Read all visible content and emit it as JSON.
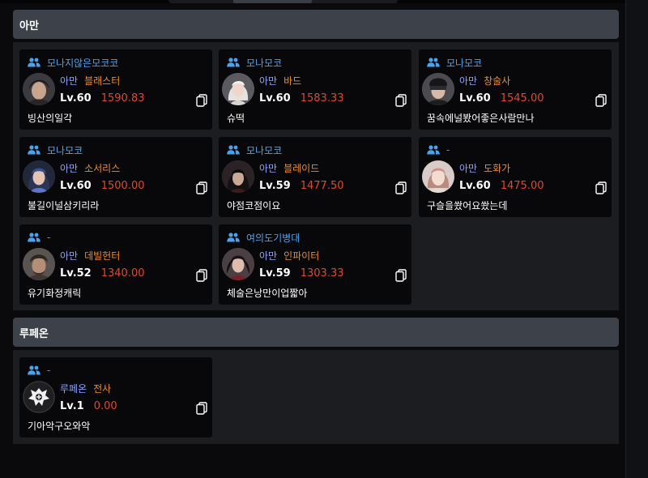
{
  "servers": [
    {
      "name": "아만",
      "characters": [
        {
          "guild": "모나지않은모코코",
          "server": "아만",
          "class": "블래스터",
          "level": "Lv.60",
          "item_level": "1590.83",
          "name": "빙산의일각",
          "avatar": "male-dark-hair"
        },
        {
          "guild": "모나모코",
          "server": "아만",
          "class": "바드",
          "level": "Lv.60",
          "item_level": "1583.33",
          "name": "슈떡",
          "avatar": "female-white-hair"
        },
        {
          "guild": "모나모코",
          "server": "아만",
          "class": "창술사",
          "level": "Lv.60",
          "item_level": "1545.00",
          "name": "꿈속에널봤어좋은사람만나",
          "avatar": "lancer-mask"
        },
        {
          "guild": "모나모코",
          "server": "아만",
          "class": "소서리스",
          "level": "Lv.60",
          "item_level": "1500.00",
          "name": "불길이널삼키리라",
          "avatar": "sorceress-blue"
        },
        {
          "guild": "모나모코",
          "server": "아만",
          "class": "블레이드",
          "level": "Lv.59",
          "item_level": "1477.50",
          "name": "야점코점이요",
          "avatar": "blade-hood"
        },
        {
          "guild": "-",
          "server": "아만",
          "class": "도화가",
          "level": "Lv.60",
          "item_level": "1475.00",
          "name": "구슬을쐈어요쐈는데",
          "avatar": "artist-pink"
        },
        {
          "guild": "-",
          "server": "아만",
          "class": "데빌헌터",
          "level": "Lv.52",
          "item_level": "1340.00",
          "name": "유기화정캐릭",
          "avatar": "devilhunter-male"
        },
        {
          "guild": "여의도기병대",
          "server": "아만",
          "class": "인파이터",
          "level": "Lv.59",
          "item_level": "1303.33",
          "name": "체술은낭만이업짧아",
          "avatar": "infighter-female"
        }
      ]
    },
    {
      "name": "루페온",
      "characters": [
        {
          "guild": "-",
          "server": "루페온",
          "class": "전사",
          "level": "Lv.1",
          "item_level": "0.00",
          "name": "기아악구오와악",
          "avatar": "warrior-emblem"
        }
      ]
    }
  ],
  "colors": {
    "guild": "#4aa3f0",
    "server": "#8aa4ff",
    "class": "#f08a2a",
    "item_level": "#e0492e",
    "header_bg": "#3d4149",
    "panel_bg": "#1c1d21",
    "card_bg": "#08080a"
  },
  "icons": {
    "guild": "users-icon",
    "copy": "copy-icon"
  }
}
